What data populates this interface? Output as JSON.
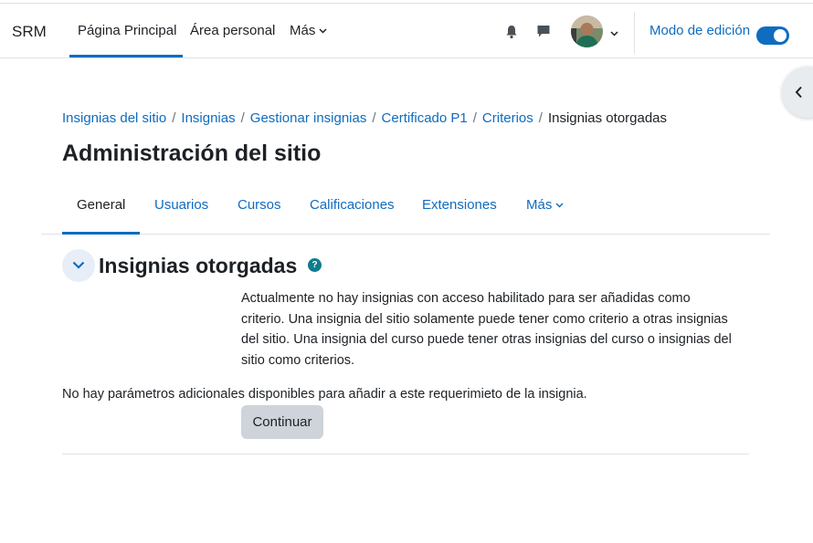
{
  "navbar": {
    "brand": "SRM",
    "items": [
      {
        "label": "Página Principal"
      },
      {
        "label": "Área personal"
      },
      {
        "label": "Más"
      }
    ],
    "edit_mode_label": "Modo de edición",
    "edit_mode_on": true
  },
  "breadcrumb": {
    "items": [
      "Insignias del sitio",
      "Insignias",
      "Gestionar insignias",
      "Certificado P1",
      "Criterios"
    ],
    "current": "Insignias otorgadas",
    "separator": "/"
  },
  "page_title": "Administración del sitio",
  "subnav": {
    "items": [
      "General",
      "Usuarios",
      "Cursos",
      "Calificaciones",
      "Extensiones",
      "Más"
    ],
    "active": "General"
  },
  "section": {
    "title": "Insignias otorgadas",
    "help_glyph": "?",
    "description_lines": [
      "Actualmente no hay insignias con acceso habilitado para ser añadidas como",
      "criterio. Una insignia del sitio solamente puede tener como criterio a otras insignias",
      "del sitio. Una insignia del curso puede tener otras insignias del curso o insignias del",
      "sitio como criterios."
    ],
    "note": "No hay parámetros adicionales disponibles para añadir a este requerimieto de la insignia.",
    "continue_label": "Continuar"
  },
  "colors": {
    "primary": "#0f6cbf",
    "text": "#1d2125",
    "button_secondary": "#ced4da",
    "help_icon": "#0f7c8c"
  }
}
